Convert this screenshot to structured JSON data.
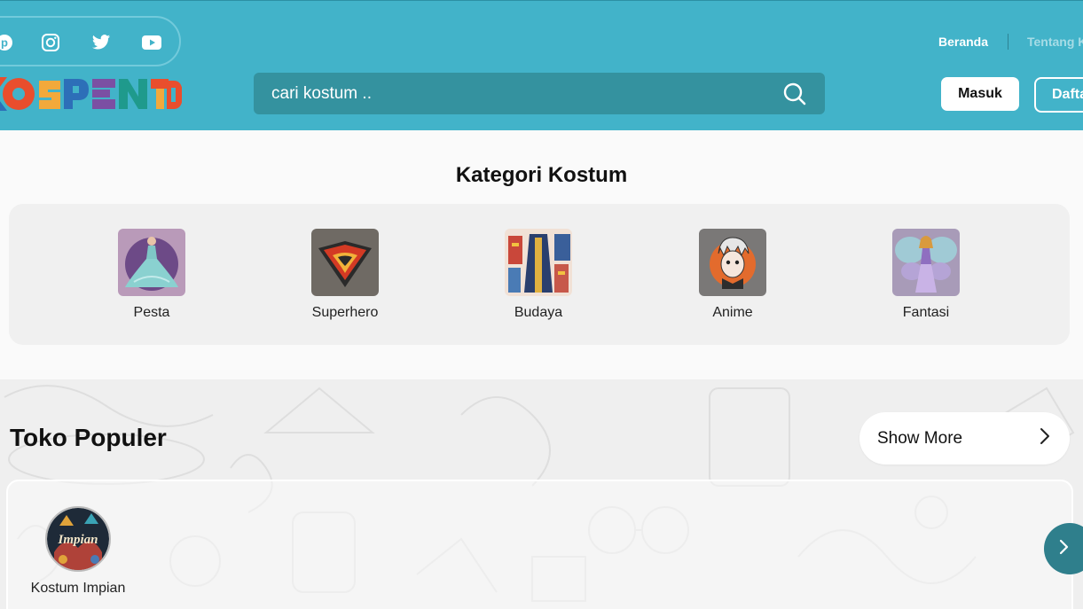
{
  "header": {
    "social_icons": [
      "pinterest-icon",
      "instagram-icon",
      "twitter-icon",
      "youtube-icon"
    ],
    "logo_text": "KOSPENTD",
    "search_placeholder": "cari kostum ..",
    "nav": [
      "Beranda",
      "Tentang K"
    ],
    "login_label": "Masuk",
    "register_label": "Dafta"
  },
  "categories": {
    "title": "Kategori Kostum",
    "items": [
      {
        "label": "Pesta",
        "icon": "party-dress-icon"
      },
      {
        "label": "Superhero",
        "icon": "superhero-emblem-icon"
      },
      {
        "label": "Budaya",
        "icon": "traditional-clothes-icon"
      },
      {
        "label": "Anime",
        "icon": "anime-character-icon"
      },
      {
        "label": "Fantasi",
        "icon": "fairy-icon"
      }
    ]
  },
  "toko": {
    "title": "Toko Populer",
    "show_more": "Show More",
    "stores": [
      {
        "name": "Kostum Impian",
        "avatar_text": "Impian"
      }
    ]
  },
  "colors": {
    "header_bg": "#42b3c9",
    "search_bg": "#34929f",
    "next_button": "#2f7f8c"
  }
}
